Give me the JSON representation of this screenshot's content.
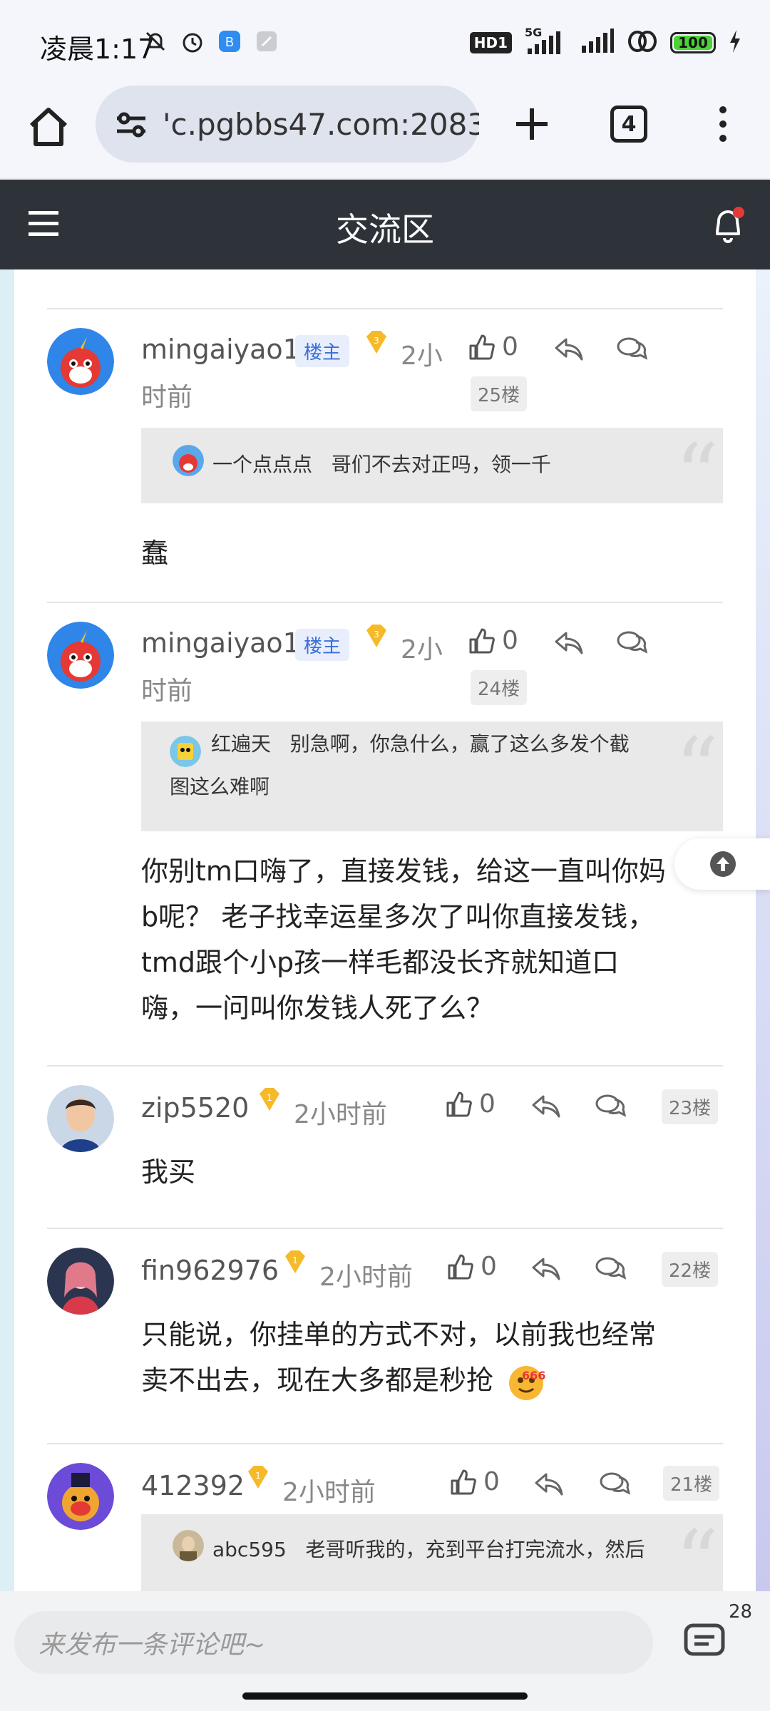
{
  "status_bar": {
    "time": "凌晨1:17",
    "network_badge": "HD1",
    "network_type": "5G",
    "battery": "100"
  },
  "browser": {
    "url": "'c.pgbbs47.com:2083",
    "tab_count": "4"
  },
  "header": {
    "title": "交流区"
  },
  "posts": [
    {
      "username": "mingaiyao1",
      "badge": "楼主",
      "level": "3",
      "time_line1": "2小",
      "time_line2": "时前",
      "likes": "0",
      "floor": "25楼",
      "quote": {
        "user": "一个点点点",
        "text": "哥们不去对正吗，领一千"
      },
      "body": "蠢"
    },
    {
      "username": "mingaiyao1",
      "badge": "楼主",
      "level": "3",
      "time_line1": "2小",
      "time_line2": "时前",
      "likes": "0",
      "floor": "24楼",
      "quote": {
        "user": "红遍天",
        "text_line1": "别急啊，你急什么，赢了这么多发个截",
        "text_line2": "图这么难啊"
      },
      "body_lines": [
        "你别tm口嗨了，直接发钱，给这一直叫你妈",
        "b呢？  老子找幸运星多次了叫你直接发钱，",
        "tmd跟个小p孩一样毛都没长齐就知道口",
        "嗨，一问叫你发钱人死了么？"
      ]
    },
    {
      "username": "zip5520",
      "level": "1",
      "time": "2小时前",
      "likes": "0",
      "floor": "23楼",
      "body": "我买"
    },
    {
      "username": "fin962976",
      "level": "1",
      "time": "2小时前",
      "likes": "0",
      "floor": "22楼",
      "body_lines": [
        "只能说，你挂单的方式不对，以前我也经常",
        "卖不出去，现在大多都是秒抢"
      ],
      "emoji_label": "666"
    },
    {
      "username": "412392",
      "level": "1",
      "time": "2小时前",
      "likes": "0",
      "floor": "21楼",
      "quote": {
        "user": "abc595",
        "text": "老哥听我的，充到平台打完流水，然后"
      }
    }
  ],
  "comment_bar": {
    "placeholder": "来发布一条评论吧~",
    "count": "28"
  },
  "colors": {
    "header_bg": "#2e3339",
    "owner_badge": "#3a6fd8",
    "notification_dot": "#e53935"
  }
}
